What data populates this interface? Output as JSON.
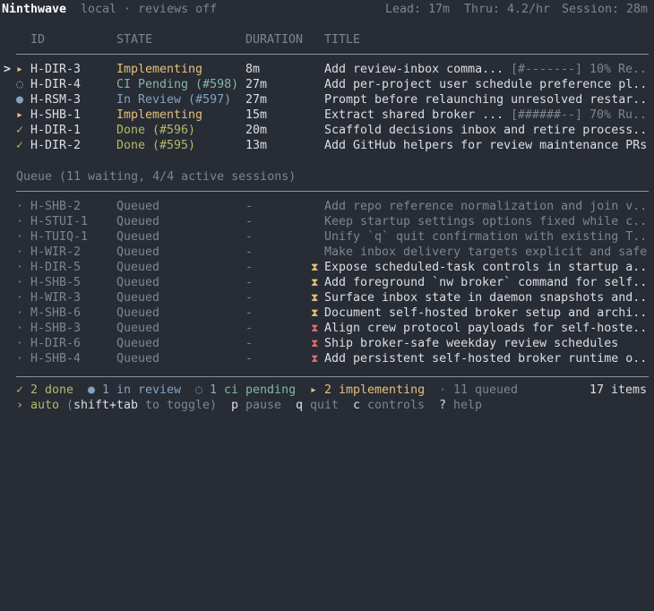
{
  "header": {
    "app_name": "Ninthwave",
    "context": "local · reviews off",
    "lead": "Lead: 17m",
    "thru": "Thru: 4.2/hr",
    "session": "Session: 28m"
  },
  "columns": {
    "id": "ID",
    "state": "STATE",
    "duration": "DURATION",
    "title": "TITLE"
  },
  "active": [
    {
      "cursor": ">",
      "icon": "▸",
      "id": "H-DIR-3",
      "state": "Implementing",
      "state_kind": "impl",
      "duration": "8m",
      "title": "Add review-inbox comma...",
      "progress_bar": "[#-------]",
      "progress": "10%",
      "progress_note": "Re.."
    },
    {
      "cursor": "",
      "icon": "◌",
      "id": "H-DIR-4",
      "state": "CI Pending (#598)",
      "state_kind": "ci",
      "duration": "27m",
      "title": "Add per-project user schedule preference pl.."
    },
    {
      "cursor": "",
      "icon": "●",
      "id": "H-RSM-3",
      "state": "In Review (#597)",
      "state_kind": "rev",
      "duration": "27m",
      "title": "Prompt before relaunching unresolved restar.."
    },
    {
      "cursor": "",
      "icon": "▸",
      "id": "H-SHB-1",
      "state": "Implementing",
      "state_kind": "impl",
      "duration": "15m",
      "title": "Extract shared broker ...",
      "progress_bar": "[######--]",
      "progress": "70%",
      "progress_note": "Ru.."
    },
    {
      "cursor": "",
      "icon": "✓",
      "id": "H-DIR-1",
      "state": "Done (#596)",
      "state_kind": "done",
      "duration": "20m",
      "title": "Scaffold decisions inbox and retire process.."
    },
    {
      "cursor": "",
      "icon": "✓",
      "id": "H-DIR-2",
      "state": "Done (#595)",
      "state_kind": "done",
      "duration": "13m",
      "title": "Add GitHub helpers for review maintenance PRs"
    }
  ],
  "queue_header": "Queue (11 waiting, 4/4 active sessions)",
  "queue": [
    {
      "icon": "·",
      "id": "H-SHB-2",
      "state": "Queued",
      "duration": "-",
      "hourglass": "",
      "title": "Add repo reference normalization and join v.."
    },
    {
      "icon": "·",
      "id": "H-STUI-1",
      "state": "Queued",
      "duration": "-",
      "hourglass": "",
      "title": "Keep startup settings options fixed while c.."
    },
    {
      "icon": "·",
      "id": "H-TUIQ-1",
      "state": "Queued",
      "duration": "-",
      "hourglass": "",
      "title": "Unify `q` quit confirmation with existing T.."
    },
    {
      "icon": "·",
      "id": "H-WIR-2",
      "state": "Queued",
      "duration": "-",
      "hourglass": "",
      "title": "Make inbox delivery targets explicit and safe"
    },
    {
      "icon": "·",
      "id": "H-DIR-5",
      "state": "Queued",
      "duration": "-",
      "hourglass": "yellow",
      "title": "Expose scheduled-task controls in startup a.."
    },
    {
      "icon": "·",
      "id": "H-SHB-5",
      "state": "Queued",
      "duration": "-",
      "hourglass": "yellow",
      "title": "Add foreground `nw broker` command for self.."
    },
    {
      "icon": "·",
      "id": "H-WIR-3",
      "state": "Queued",
      "duration": "-",
      "hourglass": "yellow",
      "title": "Surface inbox state in daemon snapshots and.."
    },
    {
      "icon": "·",
      "id": "M-SHB-6",
      "state": "Queued",
      "duration": "-",
      "hourglass": "yellow",
      "title": "Document self-hosted broker setup and archi.."
    },
    {
      "icon": "·",
      "id": "H-SHB-3",
      "state": "Queued",
      "duration": "-",
      "hourglass": "red",
      "title": "Align crew protocol payloads for self-hoste.."
    },
    {
      "icon": "·",
      "id": "H-DIR-6",
      "state": "Queued",
      "duration": "-",
      "hourglass": "red",
      "title": "Ship broker-safe weekday review schedules"
    },
    {
      "icon": "·",
      "id": "H-SHB-4",
      "state": "Queued",
      "duration": "-",
      "hourglass": "red",
      "title": "Add persistent self-hosted broker runtime o.."
    }
  ],
  "summary": {
    "done": "✓ 2 done",
    "review": "● 1 in review",
    "ci": "◌ 1 ci pending",
    "impl": "▸ 2 implementing",
    "queued": "· 11 queued",
    "items": "17 items"
  },
  "footer": {
    "prompt": "›",
    "mode": "auto",
    "toggle_open": "(",
    "toggle_key": "shift+tab",
    "toggle_text": " to toggle)",
    "pause_key": "p",
    "pause": "pause",
    "quit_key": "q",
    "quit": "quit",
    "controls_key": "c",
    "controls": "controls",
    "help_key": "?",
    "help": "help"
  },
  "colors": {
    "background": "#282c34",
    "implementing": "#e5c07b",
    "ci": "#82b7a8",
    "review": "#7fa2c6",
    "done": "#b5b86c",
    "red": "#e06c75",
    "dim": "#7f848e"
  }
}
